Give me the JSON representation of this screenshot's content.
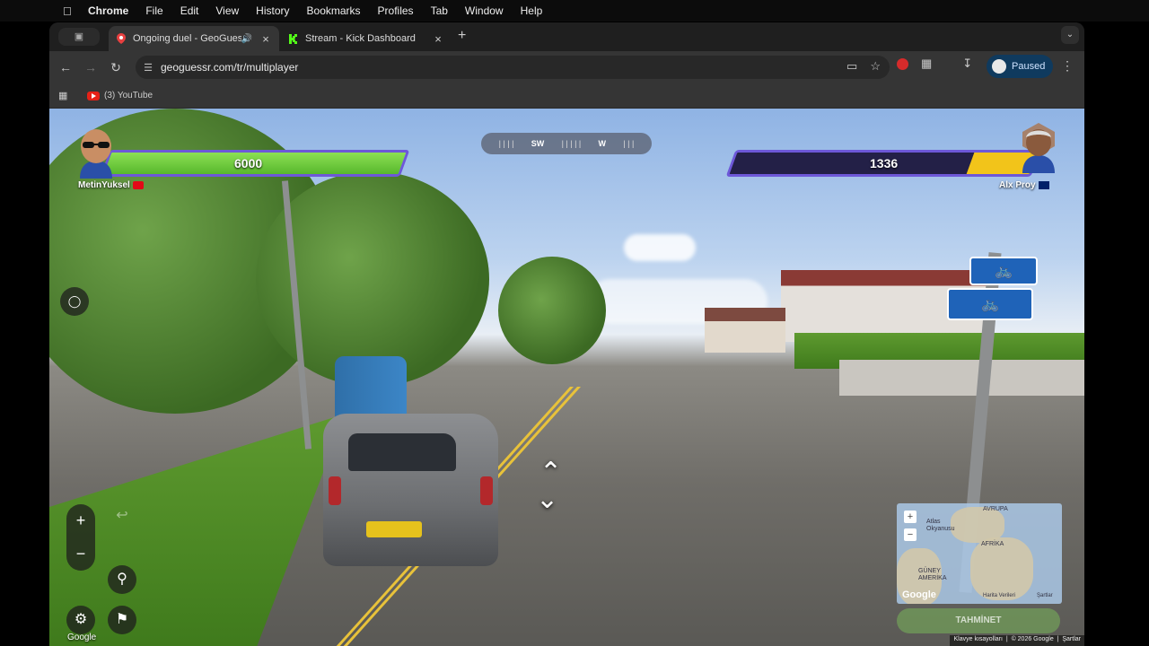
{
  "menubar": {
    "app": "Chrome",
    "items": [
      "File",
      "Edit",
      "View",
      "History",
      "Bookmarks",
      "Profiles",
      "Tab",
      "Window",
      "Help"
    ]
  },
  "tabs": [
    {
      "title": "Ongoing duel - GeoGuessr",
      "active": true,
      "favicon": "geoguessr-pin-icon"
    },
    {
      "title": "Stream - Kick Dashboard",
      "active": false,
      "favicon": "kick-logo-icon"
    }
  ],
  "toolbar": {
    "url": "geoguessr.com/tr/multiplayer",
    "profile_status": "Paused"
  },
  "bookmarks": [
    {
      "label": "(3) YouTube"
    }
  ],
  "game": {
    "player_left": {
      "name": "MetinYuksel",
      "health": "6000",
      "flag": "TR"
    },
    "player_right": {
      "name": "Alx Proy",
      "health": "1336",
      "flag": "AU"
    },
    "compass": {
      "left": "SW",
      "right": "W"
    },
    "map": {
      "labels": [
        "AVRUPA",
        "Atlas Okyanusu",
        "AFRİKA",
        "GÜNEY AMERİKA"
      ],
      "data_label": "Harita Verileri",
      "terms": "Şartlar",
      "guess_button": "TAHMİNET"
    },
    "attribution": {
      "shortcuts": "Klavye kısayolları",
      "copyright": "© 2026 Google",
      "terms": "Şartlar"
    },
    "google_logo": "Google"
  },
  "colors": {
    "health_left": "#6fcf3d",
    "health_right_bg": "#232047",
    "health_right_fill": "#f2c41a",
    "hud_border": "#6d58d8"
  }
}
